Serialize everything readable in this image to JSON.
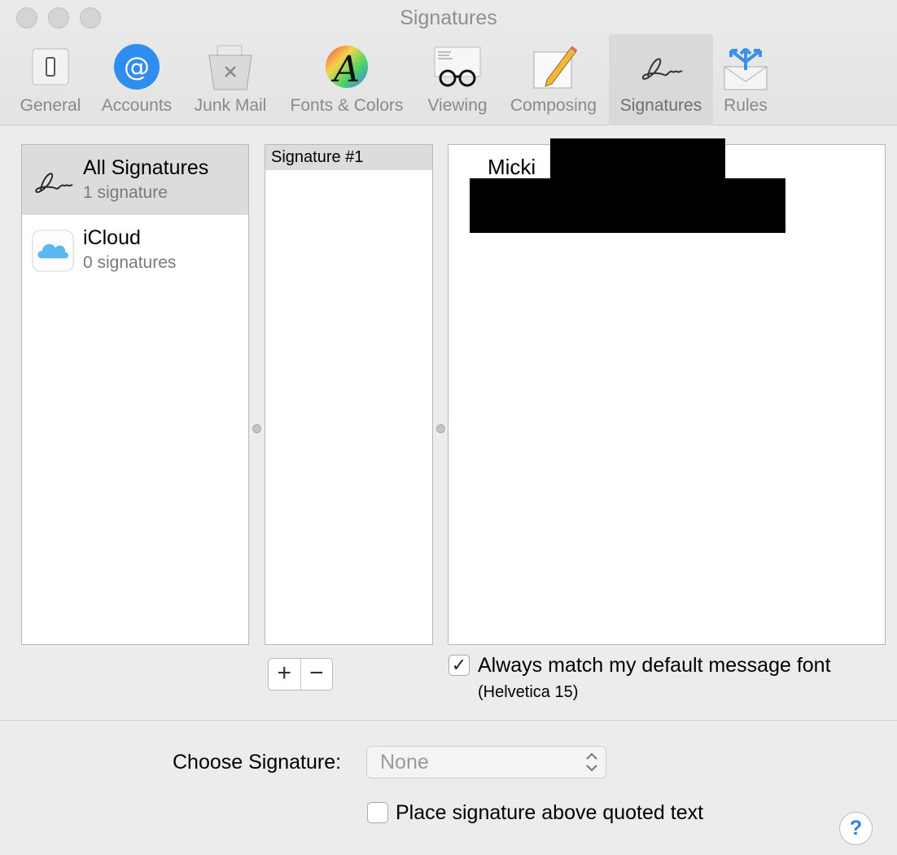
{
  "window": {
    "title": "Signatures"
  },
  "toolbar": {
    "items": [
      {
        "label": "General",
        "icon": "general-icon"
      },
      {
        "label": "Accounts",
        "icon": "accounts-icon"
      },
      {
        "label": "Junk Mail",
        "icon": "junk-mail-icon"
      },
      {
        "label": "Fonts & Colors",
        "icon": "fonts-colors-icon"
      },
      {
        "label": "Viewing",
        "icon": "viewing-icon"
      },
      {
        "label": "Composing",
        "icon": "composing-icon"
      },
      {
        "label": "Signatures",
        "icon": "signatures-icon",
        "selected": true
      },
      {
        "label": "Rules",
        "icon": "rules-icon"
      }
    ]
  },
  "accounts": [
    {
      "name": "All Signatures",
      "count": "1 signature",
      "icon": "signature-icon",
      "selected": true
    },
    {
      "name": "iCloud",
      "count": "0 signatures",
      "icon": "icloud-icon"
    }
  ],
  "signatures": [
    {
      "name": "Signature #1"
    }
  ],
  "editor": {
    "text": "Micki"
  },
  "controls": {
    "add": "+",
    "remove": "−"
  },
  "match_font": {
    "checked": true,
    "label": "Always match my default message font",
    "sub": "(Helvetica 15)"
  },
  "choose_signature": {
    "label": "Choose Signature:",
    "value": "None"
  },
  "place_above": {
    "checked": false,
    "label": "Place signature above quoted text"
  },
  "help": {
    "label": "?"
  },
  "colors": {
    "accent": "#2d7fe0",
    "selection": "#dcdcdc"
  }
}
